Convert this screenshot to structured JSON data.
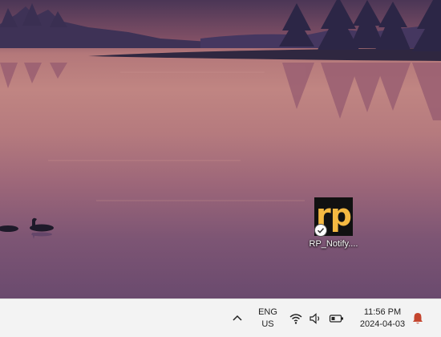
{
  "colors": {
    "sky_top": "#5b3d5f",
    "water": "#b57a7e",
    "tree": "#3e3256",
    "icon_bg": "#111111",
    "icon_accent": "#f4b942",
    "taskbar_bg": "#f3f3f3",
    "bell": "#c4452e"
  },
  "desktop": {
    "wallpaper": "lake-forest-sunset",
    "icons": [
      {
        "label": "RP_Notify....",
        "logo_text": "rp",
        "overlay_icon": "sync-checkmark-icon"
      }
    ]
  },
  "taskbar": {
    "tray_overflow_icon": "chevron-up-icon",
    "language": {
      "line1": "ENG",
      "line2": "US"
    },
    "tray_icons": [
      "wifi-icon",
      "speaker-icon",
      "battery-icon"
    ],
    "clock": {
      "time": "11:56 PM",
      "date": "2024-04-03"
    },
    "notification_icon": "bell-icon"
  }
}
